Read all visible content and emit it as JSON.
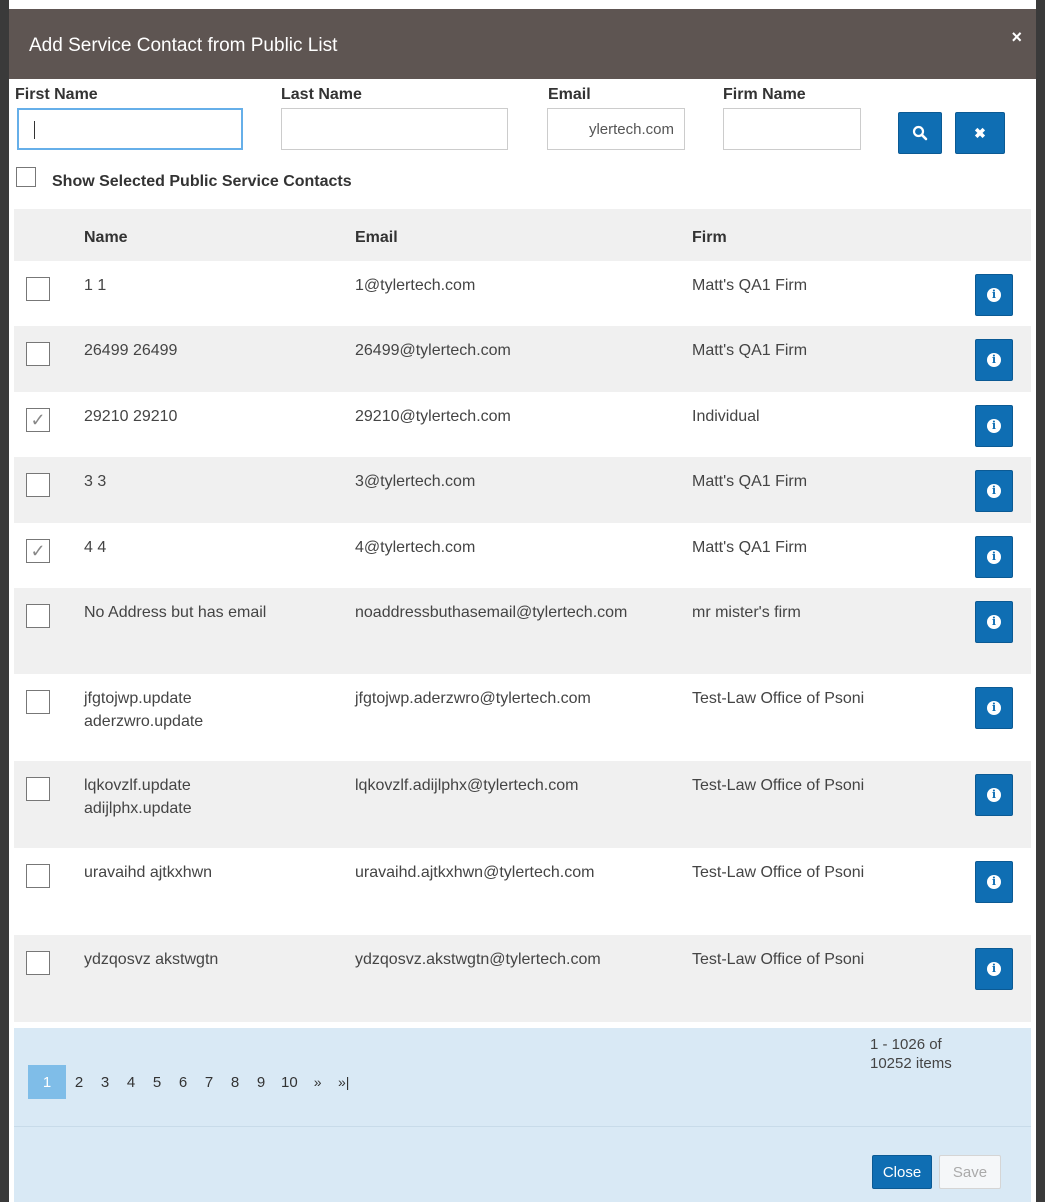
{
  "modal": {
    "title": "Add Service Contact from Public List",
    "close_glyph": "×"
  },
  "filters": {
    "first_name_label": "First Name",
    "last_name_label": "Last Name",
    "email_label": "Email",
    "firm_name_label": "Firm Name",
    "first_name_value": "",
    "last_name_value": "",
    "email_value": "ylertech.com",
    "firm_name_value": "",
    "search_icon": "search-icon",
    "clear_icon": "clear-icon",
    "clear_glyph": "✖",
    "show_selected_label": "Show Selected Public Service Contacts"
  },
  "table": {
    "columns": [
      "Name",
      "Email",
      "Firm"
    ],
    "rows": [
      {
        "name": "1 1",
        "email": "1@tylertech.com",
        "firm": "Matt's QA1 Firm",
        "checked": false
      },
      {
        "name": "26499 26499",
        "email": "26499@tylertech.com",
        "firm": "Matt's QA1 Firm",
        "checked": false
      },
      {
        "name": "29210 29210",
        "email": "29210@tylertech.com",
        "firm": "Individual",
        "checked": true
      },
      {
        "name": "3 3",
        "email": "3@tylertech.com",
        "firm": "Matt's QA1 Firm",
        "checked": false
      },
      {
        "name": "4 4",
        "email": "4@tylertech.com",
        "firm": "Matt's QA1 Firm",
        "checked": true
      },
      {
        "name": "No Address but has email",
        "email": "noaddressbuthasemail@tylertech.com",
        "firm": "mr mister's firm",
        "checked": false
      },
      {
        "name": "jfgtojwp.update aderzwro.update",
        "email": "jfgtojwp.aderzwro@tylertech.com",
        "firm": "Test-Law Office of Psoni",
        "checked": false
      },
      {
        "name": "lqkovzlf.update adijlphx.update",
        "email": "lqkovzlf.adijlphx@tylertech.com",
        "firm": "Test-Law Office of Psoni",
        "checked": false
      },
      {
        "name": "uravaihd ajtkxhwn",
        "email": "uravaihd.ajtkxhwn@tylertech.com",
        "firm": "Test-Law Office of Psoni",
        "checked": false
      },
      {
        "name": "ydzqosvz akstwgtn",
        "email": "ydzqosvz.akstwgtn@tylertech.com",
        "firm": "Test-Law Office of Psoni",
        "checked": false
      }
    ],
    "info_icon": "info-icon",
    "info_glyph": "i",
    "check_glyph": "✓"
  },
  "pager": {
    "pages": [
      "1",
      "2",
      "3",
      "4",
      "5",
      "6",
      "7",
      "8",
      "9",
      "10"
    ],
    "current_page": "1",
    "next_label": "»",
    "last_label": "»|",
    "info_line1": "1 - 1026 of",
    "info_line2": "10252 items"
  },
  "footer": {
    "close_label": "Close",
    "save_label": "Save"
  },
  "colors": {
    "header_bg": "#5e5552",
    "primary_button": "#0f6eb3",
    "pager_bg": "#d9e9f5",
    "active_page": "#7fbde8",
    "row_alt": "#f0f0f0"
  }
}
